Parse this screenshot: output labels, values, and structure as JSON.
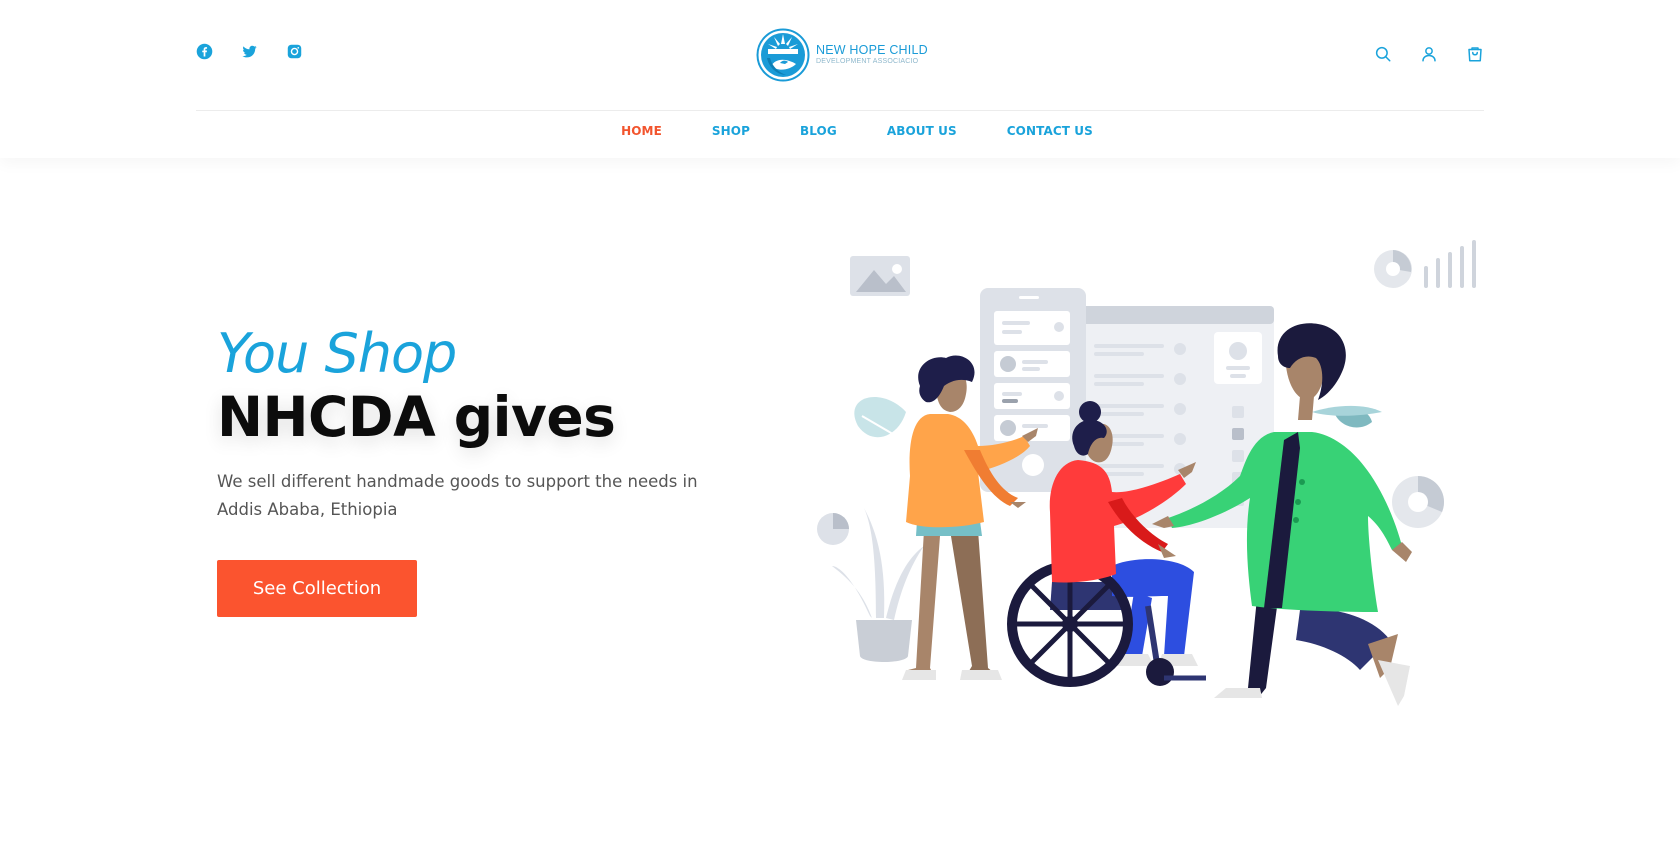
{
  "brand": {
    "name_line1": "NEW HOPE CHILD",
    "name_line2": "DEVELOPMENT ASSOCIACIO",
    "primary_color": "#1aa3db",
    "accent_color": "#fb542f"
  },
  "social": [
    {
      "icon": "facebook-icon"
    },
    {
      "icon": "twitter-icon"
    },
    {
      "icon": "instagram-icon"
    }
  ],
  "header_actions": [
    {
      "icon": "search-icon"
    },
    {
      "icon": "account-icon"
    },
    {
      "icon": "cart-icon"
    }
  ],
  "nav": {
    "items": [
      {
        "label": "HOME",
        "active": true
      },
      {
        "label": "SHOP",
        "active": false
      },
      {
        "label": "BLOG",
        "active": false
      },
      {
        "label": "ABOUT US",
        "active": false
      },
      {
        "label": "CONTACT US",
        "active": false
      }
    ]
  },
  "hero": {
    "eyebrow": "You Shop",
    "headline": "NHCDA gives",
    "description": "We sell different handmade goods to support the needs in Addis Ababa, Ethiopia",
    "cta_label": "See Collection"
  }
}
